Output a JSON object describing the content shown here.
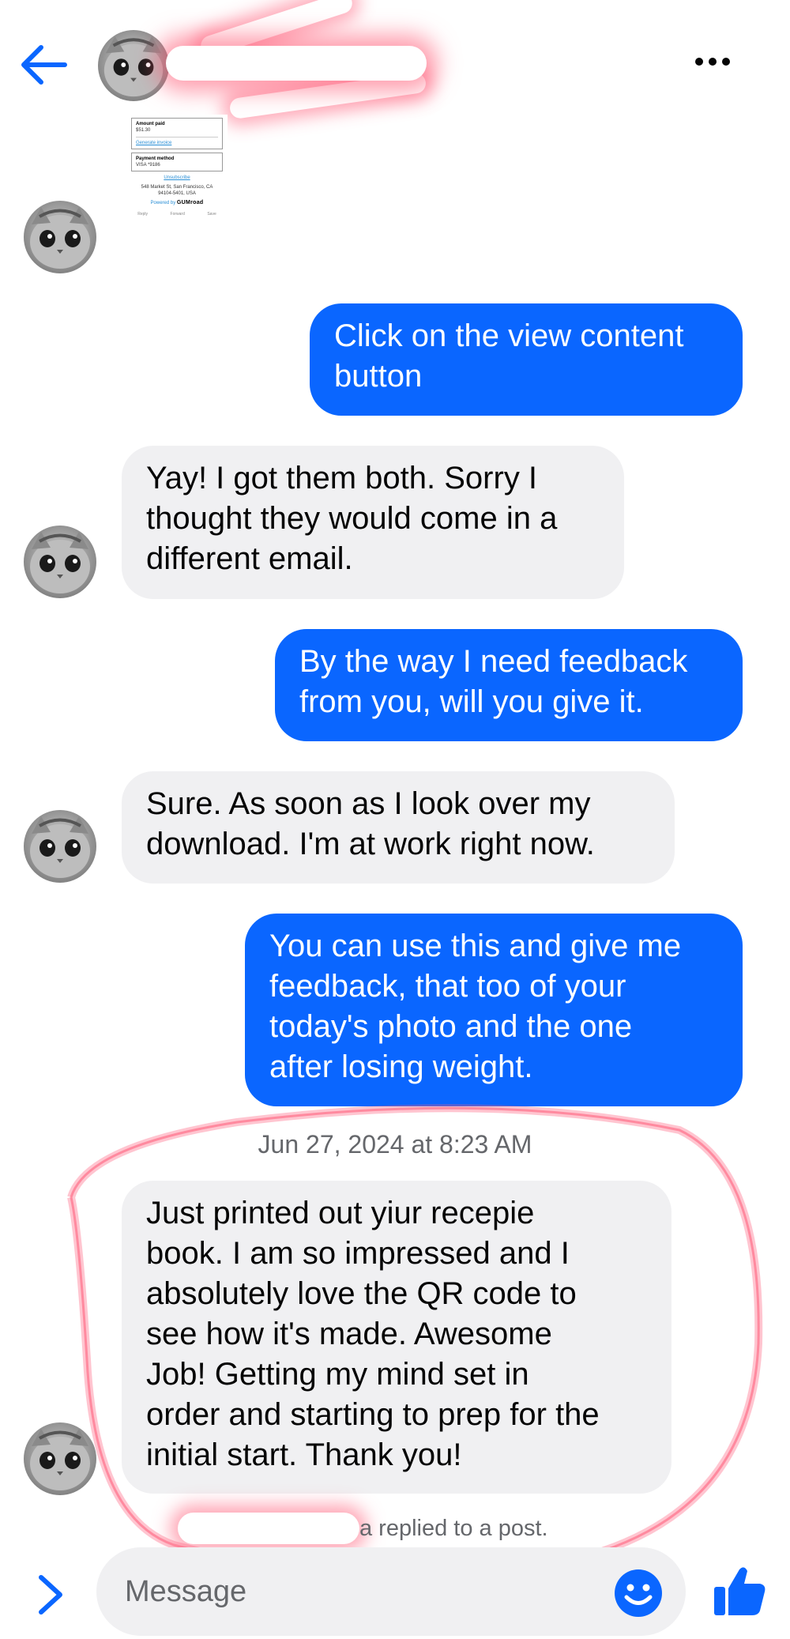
{
  "header": {
    "contact_name": ""
  },
  "receipt": {
    "amount_label": "Amount paid",
    "amount_value": "$51.30",
    "invoice_link": "Generate invoice",
    "payment_label": "Payment method",
    "payment_value": "VISA *9186",
    "unsubscribe": "Unsubscribe",
    "address1": "548 Market St, San Francisco, CA",
    "address2": "94104-5401, USA",
    "powered_by": "Powered by",
    "brand": "GUMroad",
    "foot": [
      "Reply",
      "Forward",
      "Save"
    ]
  },
  "messages": [
    {
      "from": "me",
      "text": "Click on the view content\nbutton"
    },
    {
      "from": "them",
      "text": "Yay! I got them both. Sorry I\nthought they would come in a\ndifferent email."
    },
    {
      "from": "me",
      "text": "By the way I need feedback\nfrom you, will you give it."
    },
    {
      "from": "them",
      "text": "Sure. As soon as I look over my\ndownload.  I'm at work right now."
    },
    {
      "from": "me",
      "text": "You can use this and give me\nfeedback, that too of your\ntoday's photo and the one\nafter losing weight."
    },
    {
      "from": "them",
      "text": "Just printed out yiur recepie\nbook. I am so impressed and I\nabsolutely love the QR code to\nsee how it's made. Awesome\nJob! Getting my mind set in\norder and starting to prep for the\ninitial start.  Thank you!"
    }
  ],
  "timestamp": "Jun 27, 2024 at 8:23 AM",
  "replied_note": "a replied to a post.",
  "composer": {
    "placeholder": "Message"
  },
  "colors": {
    "accent": "#0a66ff",
    "incoming_bubble": "#f0f0f2",
    "highlight": "#ff5a78"
  },
  "icons": [
    "back-arrow-icon",
    "more-icon",
    "chevron-right-icon",
    "emoji-icon",
    "thumbs-up-icon"
  ]
}
